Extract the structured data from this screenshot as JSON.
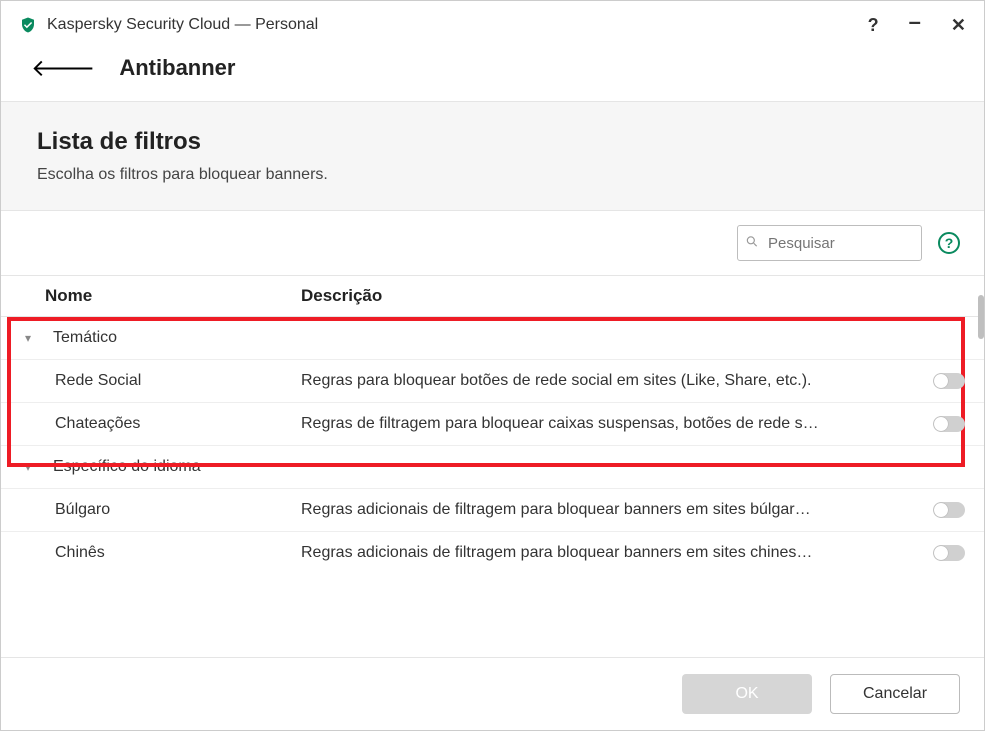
{
  "window": {
    "title": "Kaspersky Security Cloud — Personal"
  },
  "nav": {
    "section": "Antibanner"
  },
  "subheader": {
    "title": "Lista de filtros",
    "desc": "Escolha os filtros para bloquear banners."
  },
  "search": {
    "placeholder": "Pesquisar"
  },
  "table": {
    "col_name": "Nome",
    "col_desc": "Descrição",
    "group_thematic": "Temático",
    "row_social_name": "Rede Social",
    "row_social_desc": "Regras para bloquear botões de rede social em sites (Like, Share, etc.).",
    "row_annoy_name": "Chateações",
    "row_annoy_desc": "Regras de filtragem para bloquear caixas suspensas, botões de rede s…",
    "group_lang": "Específico do idioma",
    "row_bulgarian_name": "Búlgaro",
    "row_bulgarian_desc": "Regras adicionais de filtragem para bloquear banners em sites búlgar…",
    "row_chinese_name": "Chinês",
    "row_chinese_desc": "Regras adicionais de filtragem para bloquear banners em sites chines…"
  },
  "footer": {
    "ok": "OK",
    "cancel": "Cancelar"
  }
}
